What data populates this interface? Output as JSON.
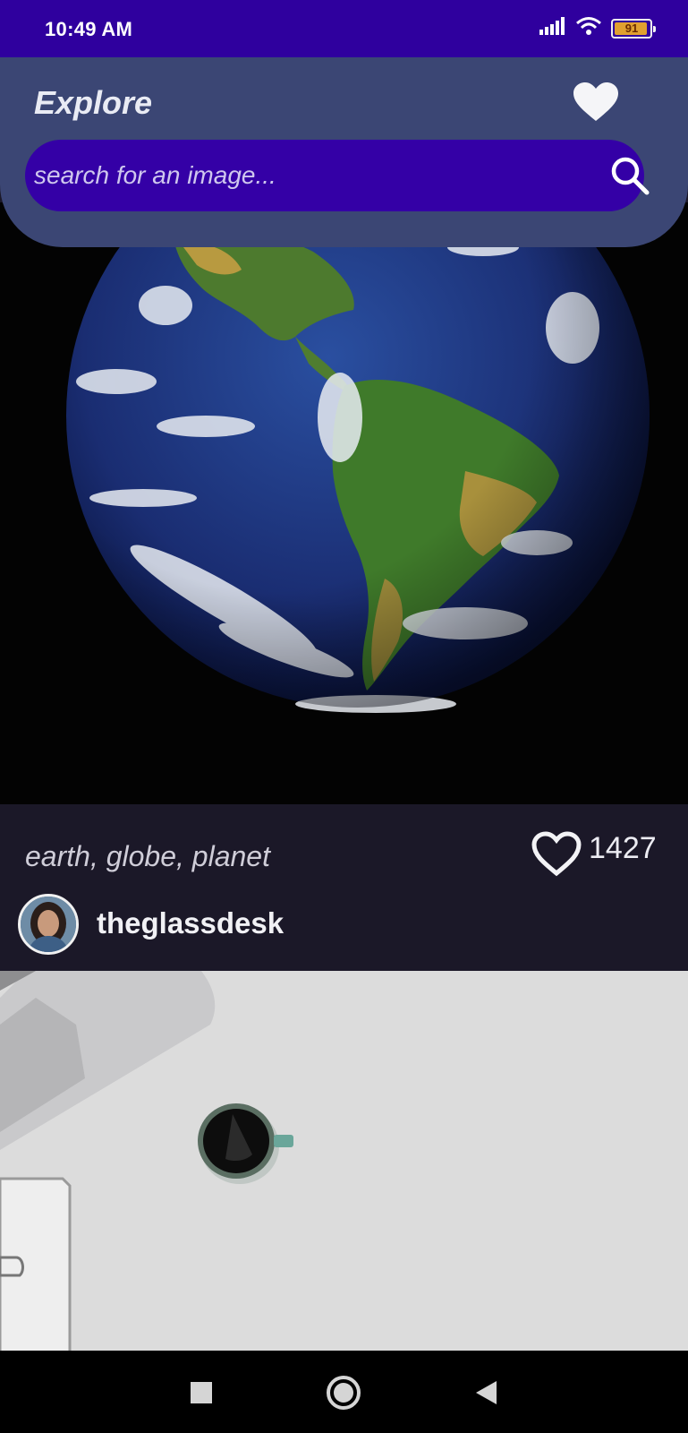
{
  "status_bar": {
    "time": "10:49 AM",
    "battery_level": "91",
    "icons": [
      "signal-icon",
      "wifi-icon",
      "battery-icon"
    ]
  },
  "header": {
    "title": "Explore",
    "favorites_icon": "heart-icon"
  },
  "search": {
    "value": "",
    "placeholder": "search for an image...",
    "icon": "search-icon"
  },
  "feed": {
    "posts": [
      {
        "image": "earth-globe-photo",
        "tags": "earth, globe, planet",
        "likes": "1427",
        "username": "theglassdesk"
      },
      {
        "image": "desk-coffee-photo"
      }
    ]
  },
  "nav_bar": {
    "buttons": [
      "recents-square-icon",
      "home-circle-icon",
      "back-triangle-icon"
    ]
  },
  "colors": {
    "status_bar": "#2f009e",
    "header": "#3b4674",
    "search_bar": "#3400a6",
    "card_background": "#1b1828",
    "nav_bar": "#000000"
  }
}
